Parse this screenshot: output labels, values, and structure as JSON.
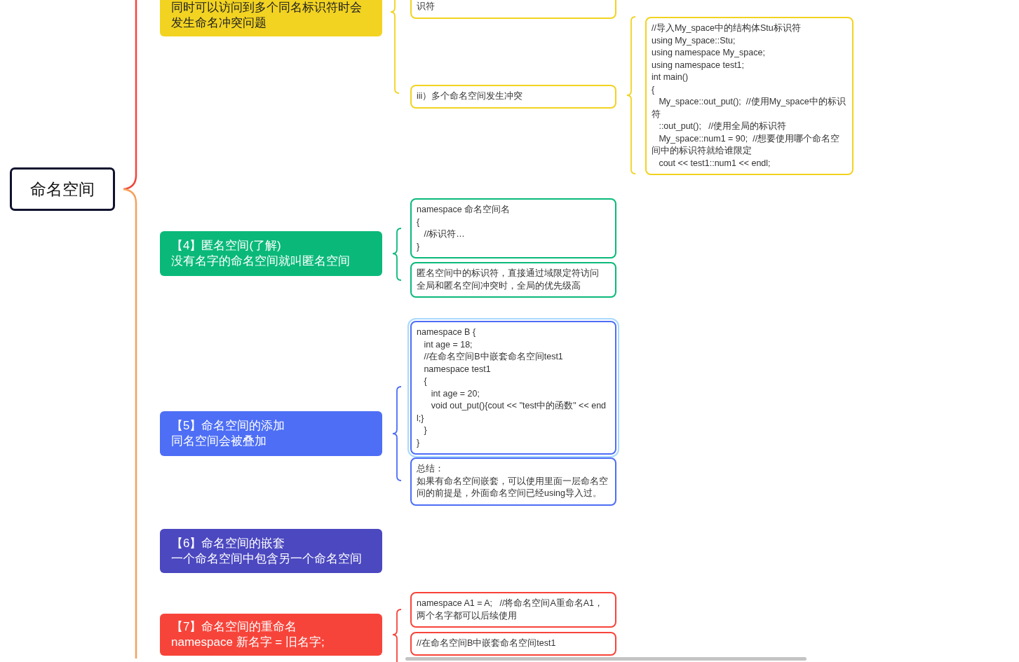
{
  "root": {
    "label": "命名空间"
  },
  "branches": [
    {
      "color": "#f2d321",
      "lines": [
        "同时可以访问到多个同名标识符时会",
        "发生命名冲突问题"
      ],
      "notes": [
        {
          "lines": [
            "识符"
          ],
          "selected": false
        },
        {
          "lines": [
            "iii）多个命名空间发生冲突"
          ],
          "selected": false,
          "children": [
            {
              "lines": [
                "//导入My_space中的结构体Stu标识符",
                "using My_space::Stu;",
                "using namespace My_space;",
                "using namespace test1;",
                "int main()",
                "{",
                "   My_space::out_put();  //使用My_space中的标识符",
                "   ::out_put();   //使用全局的标识符",
                "   My_space::num1 = 90;  //想要使用哪个命名空间中的标识符就给谁限定",
                "   cout << test1::num1 << endl;"
              ],
              "selected": false
            }
          ]
        }
      ]
    },
    {
      "color": "#0ab97a",
      "lines": [
        "【4】匿名空间(了解)",
        "没有名字的命名空间就叫匿名空间"
      ],
      "notes": [
        {
          "lines": [
            "namespace 命名空间名",
            "{",
            "   //标识符…",
            "}"
          ],
          "selected": false
        },
        {
          "lines": [
            "匿名空间中的标识符，直接通过域限定符访问",
            "全局和匿名空间冲突时，全局的优先级高"
          ],
          "selected": false
        }
      ]
    },
    {
      "color": "#4d6ef5",
      "lines": [
        "【5】命名空间的添加",
        "同名空间会被叠加"
      ],
      "notes": [
        {
          "lines": [
            "namespace B {",
            "   int age = 18;",
            "   //在命名空间B中嵌套命名空间test1",
            "   namespace test1",
            "   {",
            "      int age = 20;",
            "      void out_put(){cout << \"test中的函数\" << endl;}",
            "   }",
            "}"
          ],
          "selected": true
        },
        {
          "lines": [
            "总结：",
            "如果有命名空间嵌套，可以使用里面一层命名空间的前提是，外面命名空间已经using导入过。"
          ],
          "selected": false
        }
      ]
    },
    {
      "color": "#4b48c0",
      "lines": [
        "【6】命名空间的嵌套",
        "一个命名空间中包含另一个命名空间"
      ]
    },
    {
      "color": "#f7443a",
      "lines": [
        "【7】命名空间的重命名",
        "namespace 新名字 = 旧名字;"
      ],
      "notes": [
        {
          "lines": [
            "namespace A1 = A;   //将命名空间A重命名A1，两个名字都可以后续使用"
          ],
          "selected": false
        },
        {
          "lines": [
            "//在命名空间B中嵌套命名空间test1"
          ],
          "selected": false
        }
      ]
    }
  ]
}
